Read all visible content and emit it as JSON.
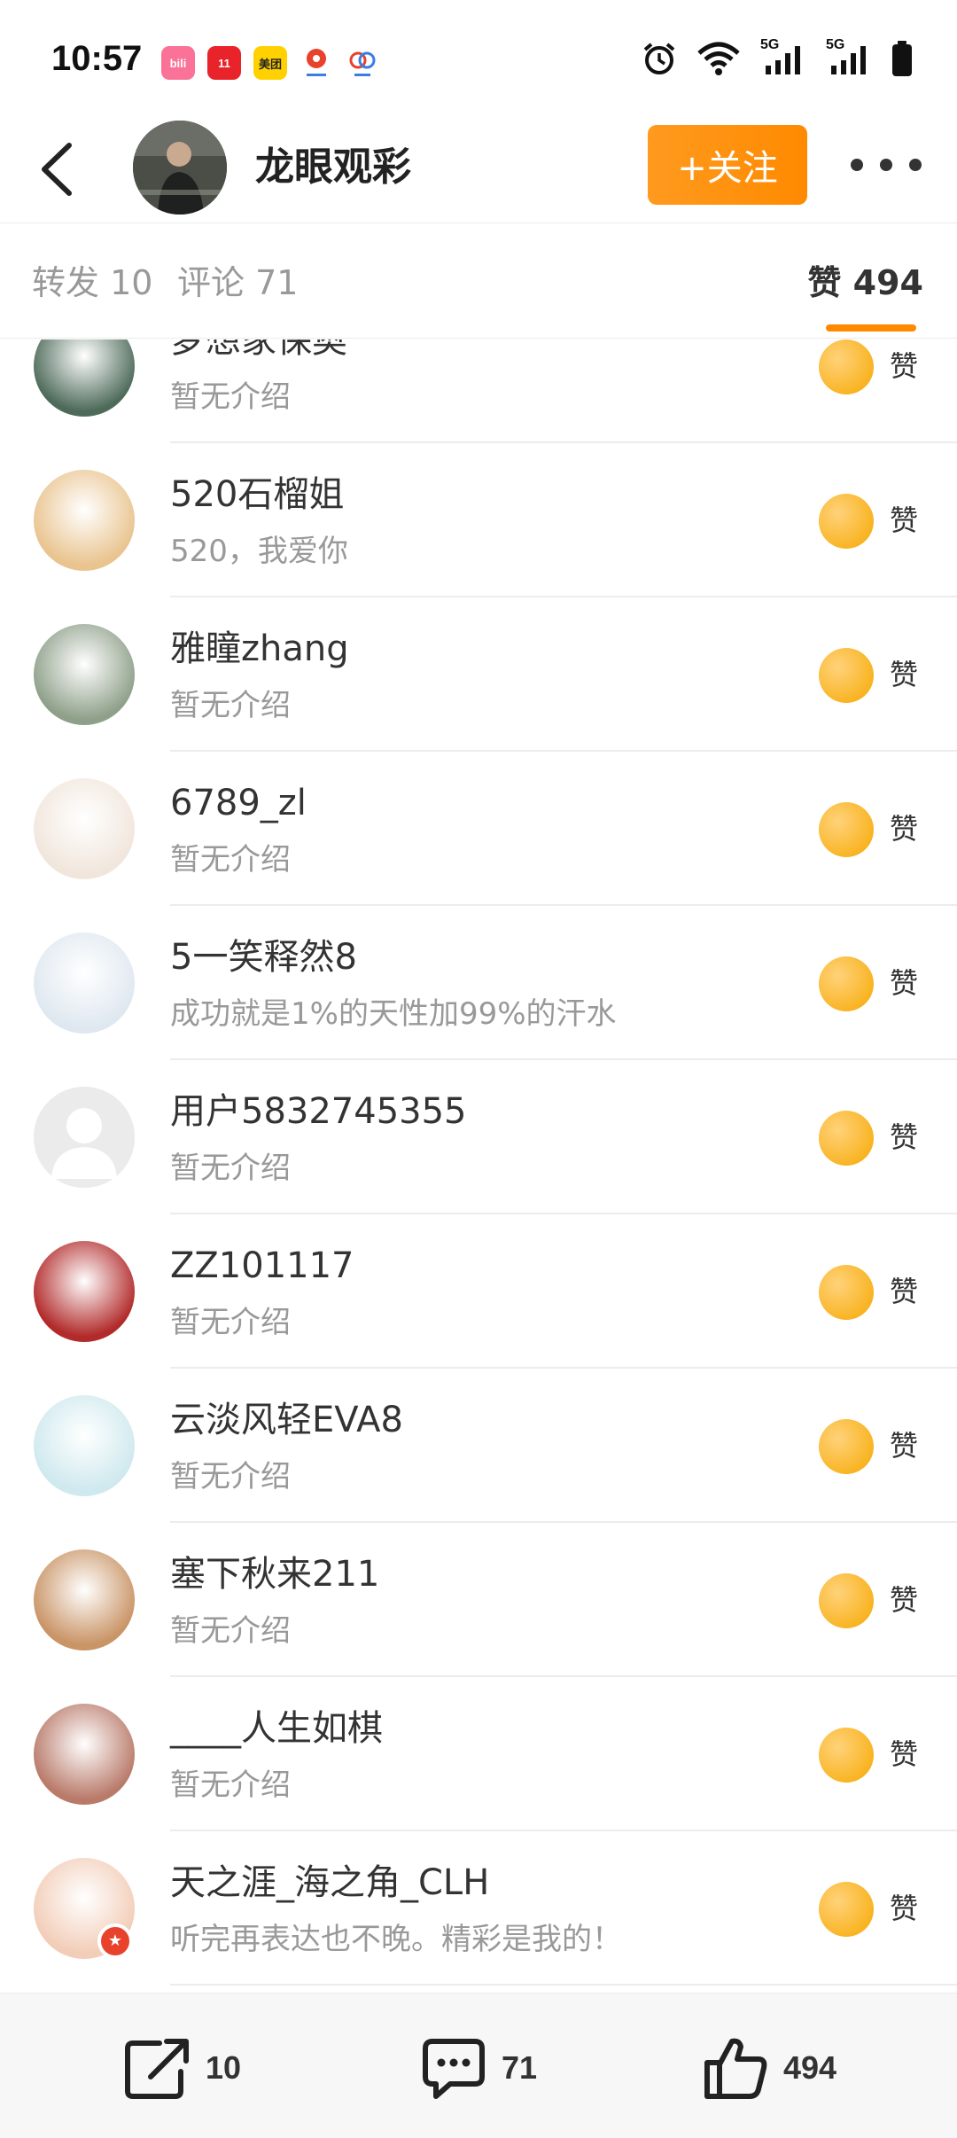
{
  "status_bar": {
    "time": "10:57",
    "apps": [
      {
        "name": "bilibili-icon",
        "label": "bili",
        "color": "#fb7299"
      },
      {
        "name": "tmall-icon",
        "label": "11.11",
        "color": "#e8242a"
      },
      {
        "name": "meituan-icon",
        "label": "美团",
        "color": "#ffd100"
      },
      {
        "name": "map-pin-icon",
        "label": "",
        "color": "#ffffff"
      },
      {
        "name": "cloud-icon",
        "label": "",
        "color": "#ffffff"
      }
    ],
    "network_1": "5G",
    "network_2": "5G"
  },
  "header": {
    "title": "龙眼观彩",
    "follow_label": "+关注"
  },
  "tabs": {
    "repost": "转发 10",
    "comment": "评论 71",
    "likes": "赞 494"
  },
  "like_action_label": "赞",
  "users": [
    {
      "name": "梦想家保奥",
      "bio": "暂无介绍",
      "avatar_color": "#4e6b5a",
      "verified": false
    },
    {
      "name": "520石榴姐",
      "bio": "520，我爱你",
      "avatar_color": "#e9c48f",
      "verified": false
    },
    {
      "name": "雅瞳zhang",
      "bio": "暂无介绍",
      "avatar_color": "#8fa08a",
      "verified": false
    },
    {
      "name": "6789_zl",
      "bio": "暂无介绍",
      "avatar_color": "#f1e6dc",
      "verified": false
    },
    {
      "name": "5一笑释然8",
      "bio": "成功就是1%的天性加99%的汗水",
      "avatar_color": "#dfe8f0",
      "verified": false
    },
    {
      "name": "用户5832745355",
      "bio": "暂无介绍",
      "avatar_color": "#e6e6e6",
      "verified": false
    },
    {
      "name": "ZZ101117",
      "bio": "暂无介绍",
      "avatar_color": "#b22a2a",
      "verified": false
    },
    {
      "name": "云淡风轻EVA8",
      "bio": "暂无介绍",
      "avatar_color": "#cfe9ee",
      "verified": false
    },
    {
      "name": "塞下秋来211",
      "bio": "暂无介绍",
      "avatar_color": "#c99466",
      "verified": false
    },
    {
      "name": "____人生如棋",
      "bio": "暂无介绍",
      "avatar_color": "#b97a6a",
      "verified": false
    },
    {
      "name": "天之涯_海之角_CLH",
      "bio": "听完再表达也不晚。精彩是我的！",
      "avatar_color": "#f2cdb8",
      "verified": true
    }
  ],
  "bottom_bar": {
    "repost_count": "10",
    "comment_count": "71",
    "like_count": "494"
  },
  "colors": {
    "accent": "#ff8a00",
    "like_gold": "#f6a800"
  }
}
